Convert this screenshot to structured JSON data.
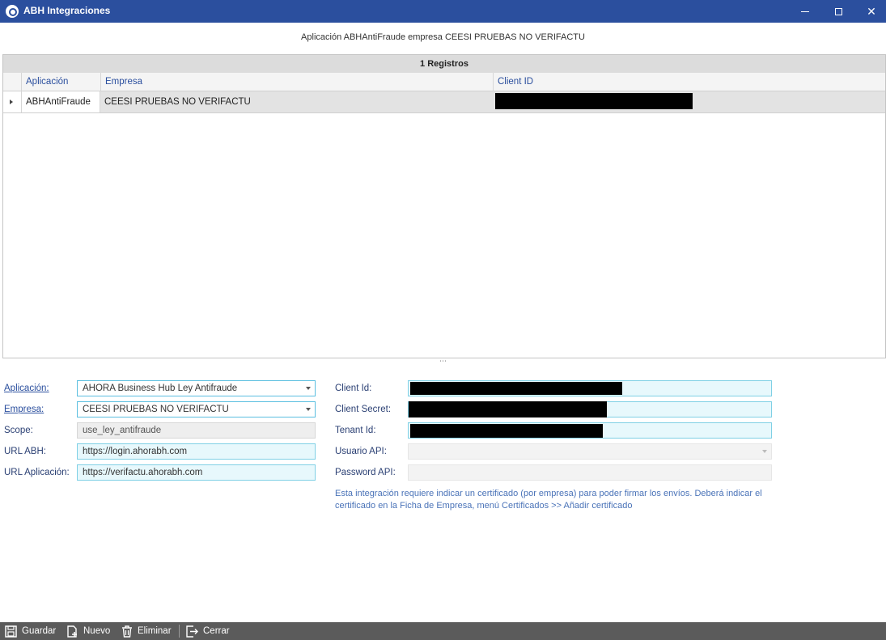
{
  "window": {
    "title": "ABH Integraciones"
  },
  "headline": "Aplicación ABHAntiFraude empresa CEESI PRUEBAS NO VERIFACTU",
  "grid": {
    "records_label": "1 Registros",
    "columns": [
      "Aplicación",
      "Empresa",
      "Client ID"
    ],
    "rows": [
      {
        "aplicacion": "ABHAntiFraude",
        "empresa": "CEESI PRUEBAS NO VERIFACTU"
      }
    ]
  },
  "form": {
    "aplicacion_label": "Aplicación:",
    "aplicacion_value": "AHORA Business Hub Ley Antifraude",
    "empresa_label": "Empresa:",
    "empresa_value": "CEESI PRUEBAS NO VERIFACTU",
    "scope_label": "Scope:",
    "scope_value": "use_ley_antifraude",
    "url_abh_label": "URL ABH:",
    "url_abh_value": "https://login.ahorabh.com",
    "url_app_label": "URL Aplicación:",
    "url_app_value": "https://verifactu.ahorabh.com",
    "client_id_label": "Client Id:",
    "client_secret_label": "Client Secret:",
    "tenant_id_label": "Tenant Id:",
    "usuario_api_label": "Usuario API:",
    "password_api_label": "Password API:",
    "note": "Esta integración requiere indicar un certificado (por empresa) para poder firmar los envíos. Deberá indicar el certificado en la Ficha de Empresa, menú Certificados >> Añadir certificado"
  },
  "toolbar": {
    "save": "Guardar",
    "new": "Nuevo",
    "delete": "Eliminar",
    "close": "Cerrar"
  },
  "colors": {
    "titlebar": "#2b4f9e",
    "toolbar": "#5b5b5b",
    "field_border": "#7fd0e5"
  }
}
